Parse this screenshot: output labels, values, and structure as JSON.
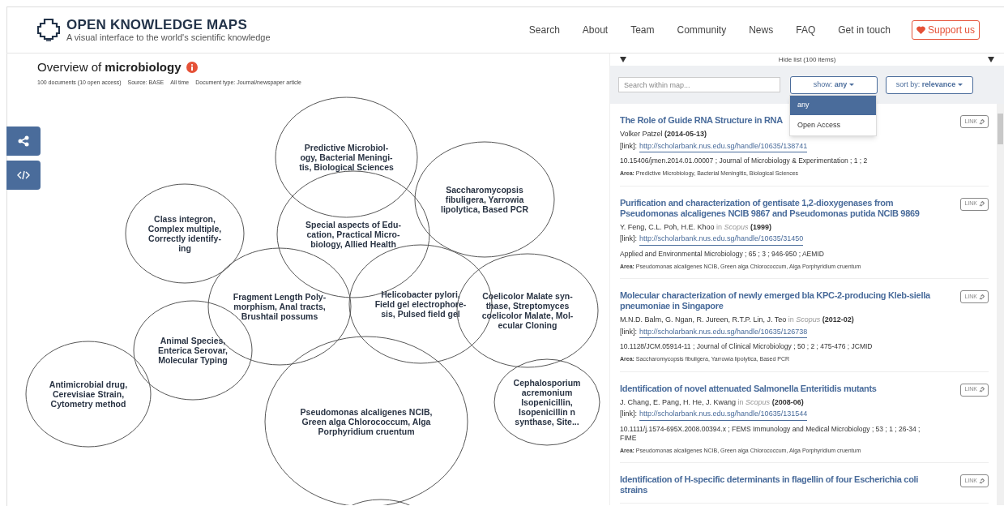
{
  "header": {
    "title": "OPEN KNOWLEDGE MAPS",
    "subtitle": "A visual interface to the world's scientific knowledge",
    "nav": [
      "Search",
      "About",
      "Team",
      "Community",
      "News",
      "FAQ",
      "Get in touch"
    ],
    "support": "Support us"
  },
  "overview": {
    "prefix": "Overview of",
    "query": "microbiology",
    "meta": [
      "100 documents (10 open access)",
      "Source: BASE",
      "All time",
      "Document type: Journal/newspaper article"
    ]
  },
  "map": {
    "bubbles": [
      {
        "lines": [
          "Predictive Microbiol-",
          "ogy, Bacterial Meningi-",
          "tis, Biological Sciences"
        ]
      },
      {
        "lines": [
          "Saccharomycopsis",
          "fibuligera, Yarrowia",
          "lipolytica, Based PCR"
        ]
      },
      {
        "lines": [
          "Class integron,",
          "Complex multiple,",
          "Correctly identify-",
          "ing"
        ]
      },
      {
        "lines": [
          "Special aspects of Edu-",
          "cation, Practical Micro-",
          "biology, Allied Health"
        ]
      },
      {
        "lines": [
          "Fragment Length Poly-",
          "morphism, Anal tracts,",
          "Brushtail possums"
        ]
      },
      {
        "lines": [
          "Helicobacter pylori,",
          "Field gel electrophore-",
          "sis, Pulsed field gel"
        ]
      },
      {
        "lines": [
          "Coelicolor Malate syn-",
          "thase, Streptomyces",
          "coelicolor Malate, Mol-",
          "ecular Cloning"
        ]
      },
      {
        "lines": [
          "Animal Species,",
          "Enterica Serovar,",
          "Molecular Typing"
        ]
      },
      {
        "lines": [
          "Antimicrobial drug,",
          "Cerevisiae Strain,",
          "Cytometry method"
        ]
      },
      {
        "lines": [
          "Pseudomonas alcaligenes NCIB,",
          "Green alga Chlorococcum, Alga",
          "Porphyridium cruentum"
        ]
      },
      {
        "lines": [
          "Cephalosporium",
          "acremonium",
          "Isopenicillin,",
          "Isopenicillin n",
          "synthase, Site..."
        ]
      }
    ]
  },
  "list": {
    "toggle": "Hide list (100 items)",
    "search": {
      "placeholder": "Search within map..."
    },
    "show": {
      "label": "show:",
      "value": "any",
      "expanded": true,
      "options": [
        {
          "label": "any",
          "selected": true
        },
        {
          "label": "Open Access",
          "selected": false
        }
      ]
    },
    "sort": {
      "label": "sort by:",
      "value": "relevance"
    },
    "items": [
      {
        "title": "The Role of Guide RNA Structure in RNA",
        "authors": "Volker Patzel",
        "date": "(2014-05-13)",
        "link_label": "[link]:",
        "url": "http://scholarbank.nus.edu.sg/handle/10635/138741",
        "meta": "10.15406/jmen.2014.01.00007 ; Journal of Microbiology & Experimentation ; 1 ; 2",
        "area_label": "Area:",
        "area": "Predictive Microbiology, Bacterial Meningitis, Biological Sciences",
        "button": "LINK"
      },
      {
        "title": "Purification and characterization of gentisate 1,2-dioxygenases from Pseudomonas alcaligenes NCIB 9867 and Pseudomonas putida NCIB 9869",
        "authors": "Y. Feng, C.L. Poh, H.E. Khoo",
        "in": "in",
        "source": "Scopus",
        "date": "(1999)",
        "link_label": "[link]:",
        "url": "http://scholarbank.nus.edu.sg/handle/10635/31450",
        "meta": "Applied and Environmental Microbiology ; 65 ; 3 ; 946-950 ; AEMID",
        "area_label": "Area:",
        "area": "Pseudomonas alcaligenes NCIB, Green alga Chlorococcum, Alga Porphyridium cruentum",
        "button": "LINK"
      },
      {
        "title": "Molecular characterization of newly emerged bla KPC-2-producing Kleb-siella pneumoniae in Singapore",
        "authors": "M.N.D. Balm, G. Ngan, R. Jureen, R.T.P. Lin, J. Teo",
        "in": "in",
        "source": "Scopus",
        "date": "(2012-02)",
        "link_label": "[link]:",
        "url": "http://scholarbank.nus.edu.sg/handle/10635/126738",
        "meta": "10.1128/JCM.05914-11 ; Journal of Clinical Microbiology ; 50 ; 2 ; 475-476 ; JCMID",
        "area_label": "Area:",
        "area": "Saccharomycopsis fibuligera, Yarrowia lipolytica, Based PCR",
        "button": "LINK"
      },
      {
        "title": "Identification of novel attenuated Salmonella Enteritidis mutants",
        "authors": "J. Chang, E. Pang, H. He, J. Kwang",
        "in": "in",
        "source": "Scopus",
        "date": "(2008-06)",
        "link_label": "[link]:",
        "url": "http://scholarbank.nus.edu.sg/handle/10635/131544",
        "meta": "10.1111/j.1574-695X.2008.00394.x ; FEMS Immunology and Medical Microbiology ; 53 ; 1 ; 26-34 ; FIME",
        "area_label": "Area:",
        "area": "Pseudomonas alcaligenes NCIB, Green alga Chlorococcum, Alga Porphyridium cruentum",
        "button": "LINK"
      },
      {
        "title": "Identification of H-specific determinants in flagellin of four Escherichia coli strains",
        "button": "LINK"
      }
    ]
  }
}
